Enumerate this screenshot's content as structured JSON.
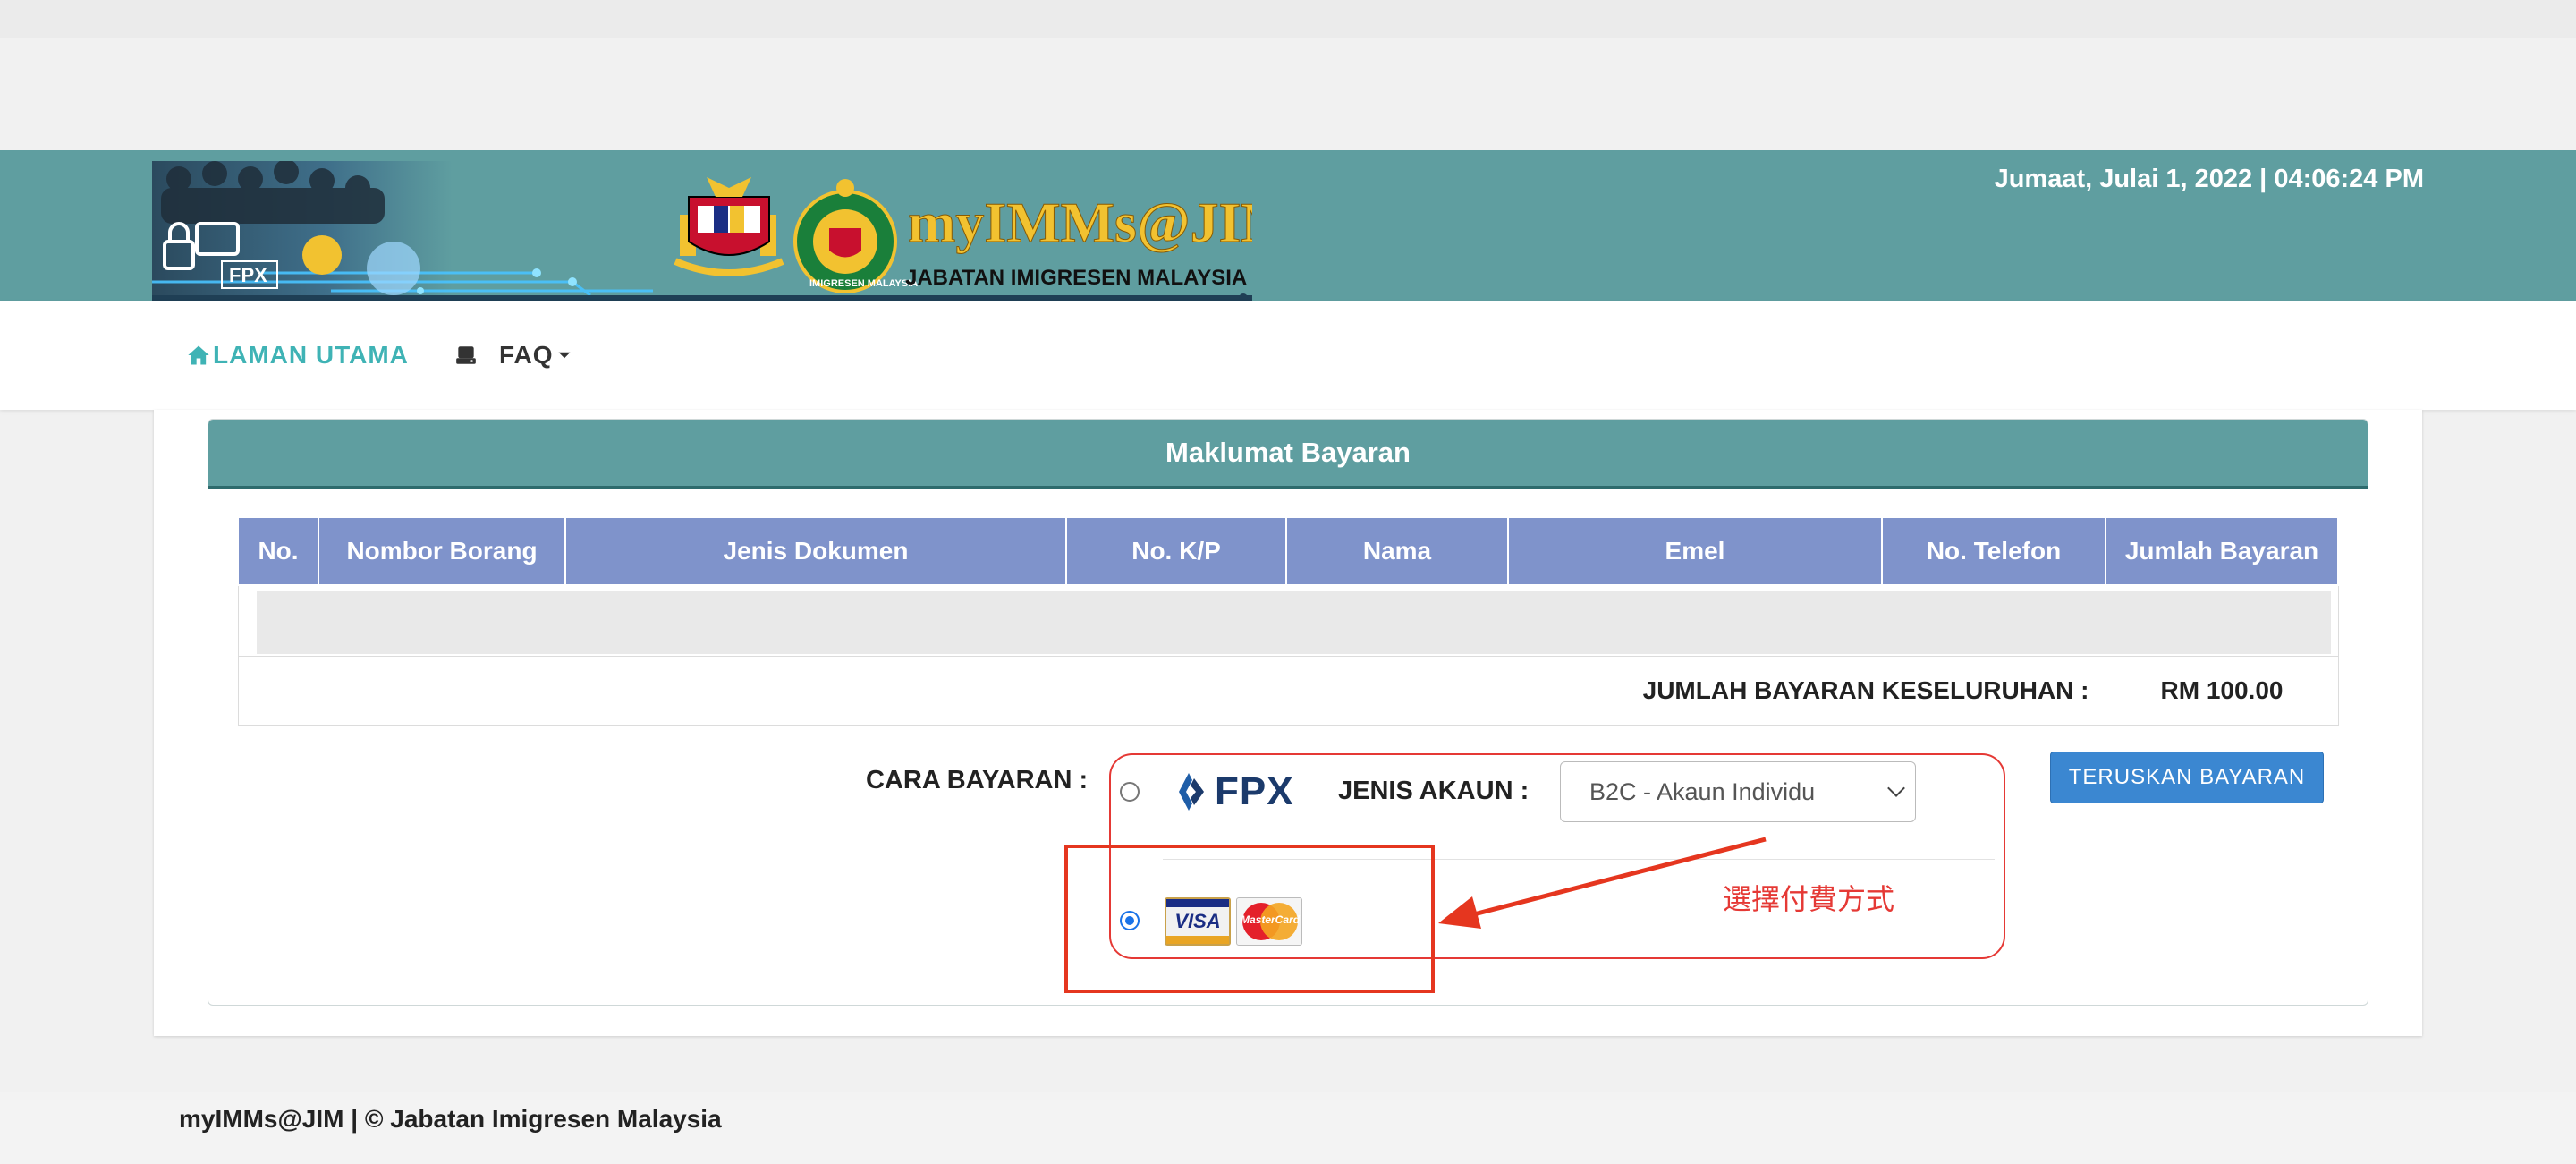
{
  "header": {
    "datetime": "Jumaat, Julai 1, 2022 | 04:06:24 PM",
    "brand_title": "myIMMs@JIM",
    "brand_subtitle": "JABATAN IMIGRESEN MALAYSIA",
    "fpx_badge": "FPX",
    "seal_text": "IMIGRESEN MALAYSIA"
  },
  "nav": {
    "home_label": "LAMAN UTAMA",
    "faq_label": "FAQ"
  },
  "panel": {
    "title": "Maklumat Bayaran"
  },
  "table": {
    "headers": [
      "No.",
      "Nombor Borang",
      "Jenis Dokumen",
      "No. K/P",
      "Nama",
      "Emel",
      "No. Telefon",
      "Jumlah Bayaran"
    ],
    "total_label": "JUMLAH BAYARAN KESELURUHAN :",
    "total_value": "RM 100.00"
  },
  "payment": {
    "method_label": "CARA BAYARAN :",
    "fpx_logo": "FPX",
    "account_type_label": "JENIS AKAUN :",
    "account_type_value": "B2C - Akaun Individu",
    "selected_method": "card",
    "visa_label": "VISA",
    "mastercard_label": "MasterCard",
    "continue_button": "TERUSKAN BAYARAN"
  },
  "annotation": {
    "text": "選擇付費方式"
  },
  "footer": {
    "text": "myIMMs@JIM | © Jabatan Imigresen Malaysia"
  },
  "colors": {
    "banner": "#5f9ea0",
    "table_header": "#7f93cb",
    "nav_active": "#3fb3b5",
    "button": "#3b87d1",
    "annotation": "#e53935"
  }
}
